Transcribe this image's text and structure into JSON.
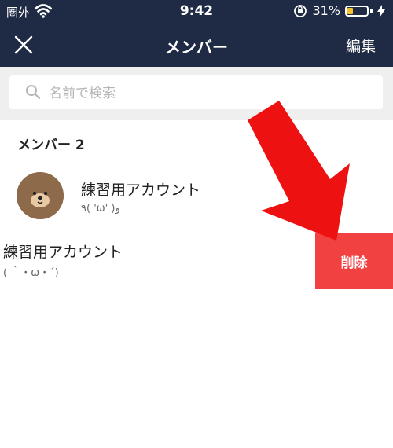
{
  "status_bar": {
    "carrier": "圏外",
    "time": "9:42",
    "battery_percent": "31%",
    "battery_level": 0.31
  },
  "header": {
    "title": "メンバー",
    "edit_label": "編集"
  },
  "search": {
    "placeholder": "名前で検索"
  },
  "section": {
    "label": "メンバー 2"
  },
  "members": [
    {
      "name": "練習用アカウント",
      "status": "٩( 'ω' )و"
    },
    {
      "name": "練習用アカウント",
      "status": "( ｀・ω・´)",
      "action_label": "削除"
    }
  ],
  "colors": {
    "header_bg": "#1f2a44",
    "delete_bg": "#f24141",
    "arrow": "#ee1111"
  }
}
